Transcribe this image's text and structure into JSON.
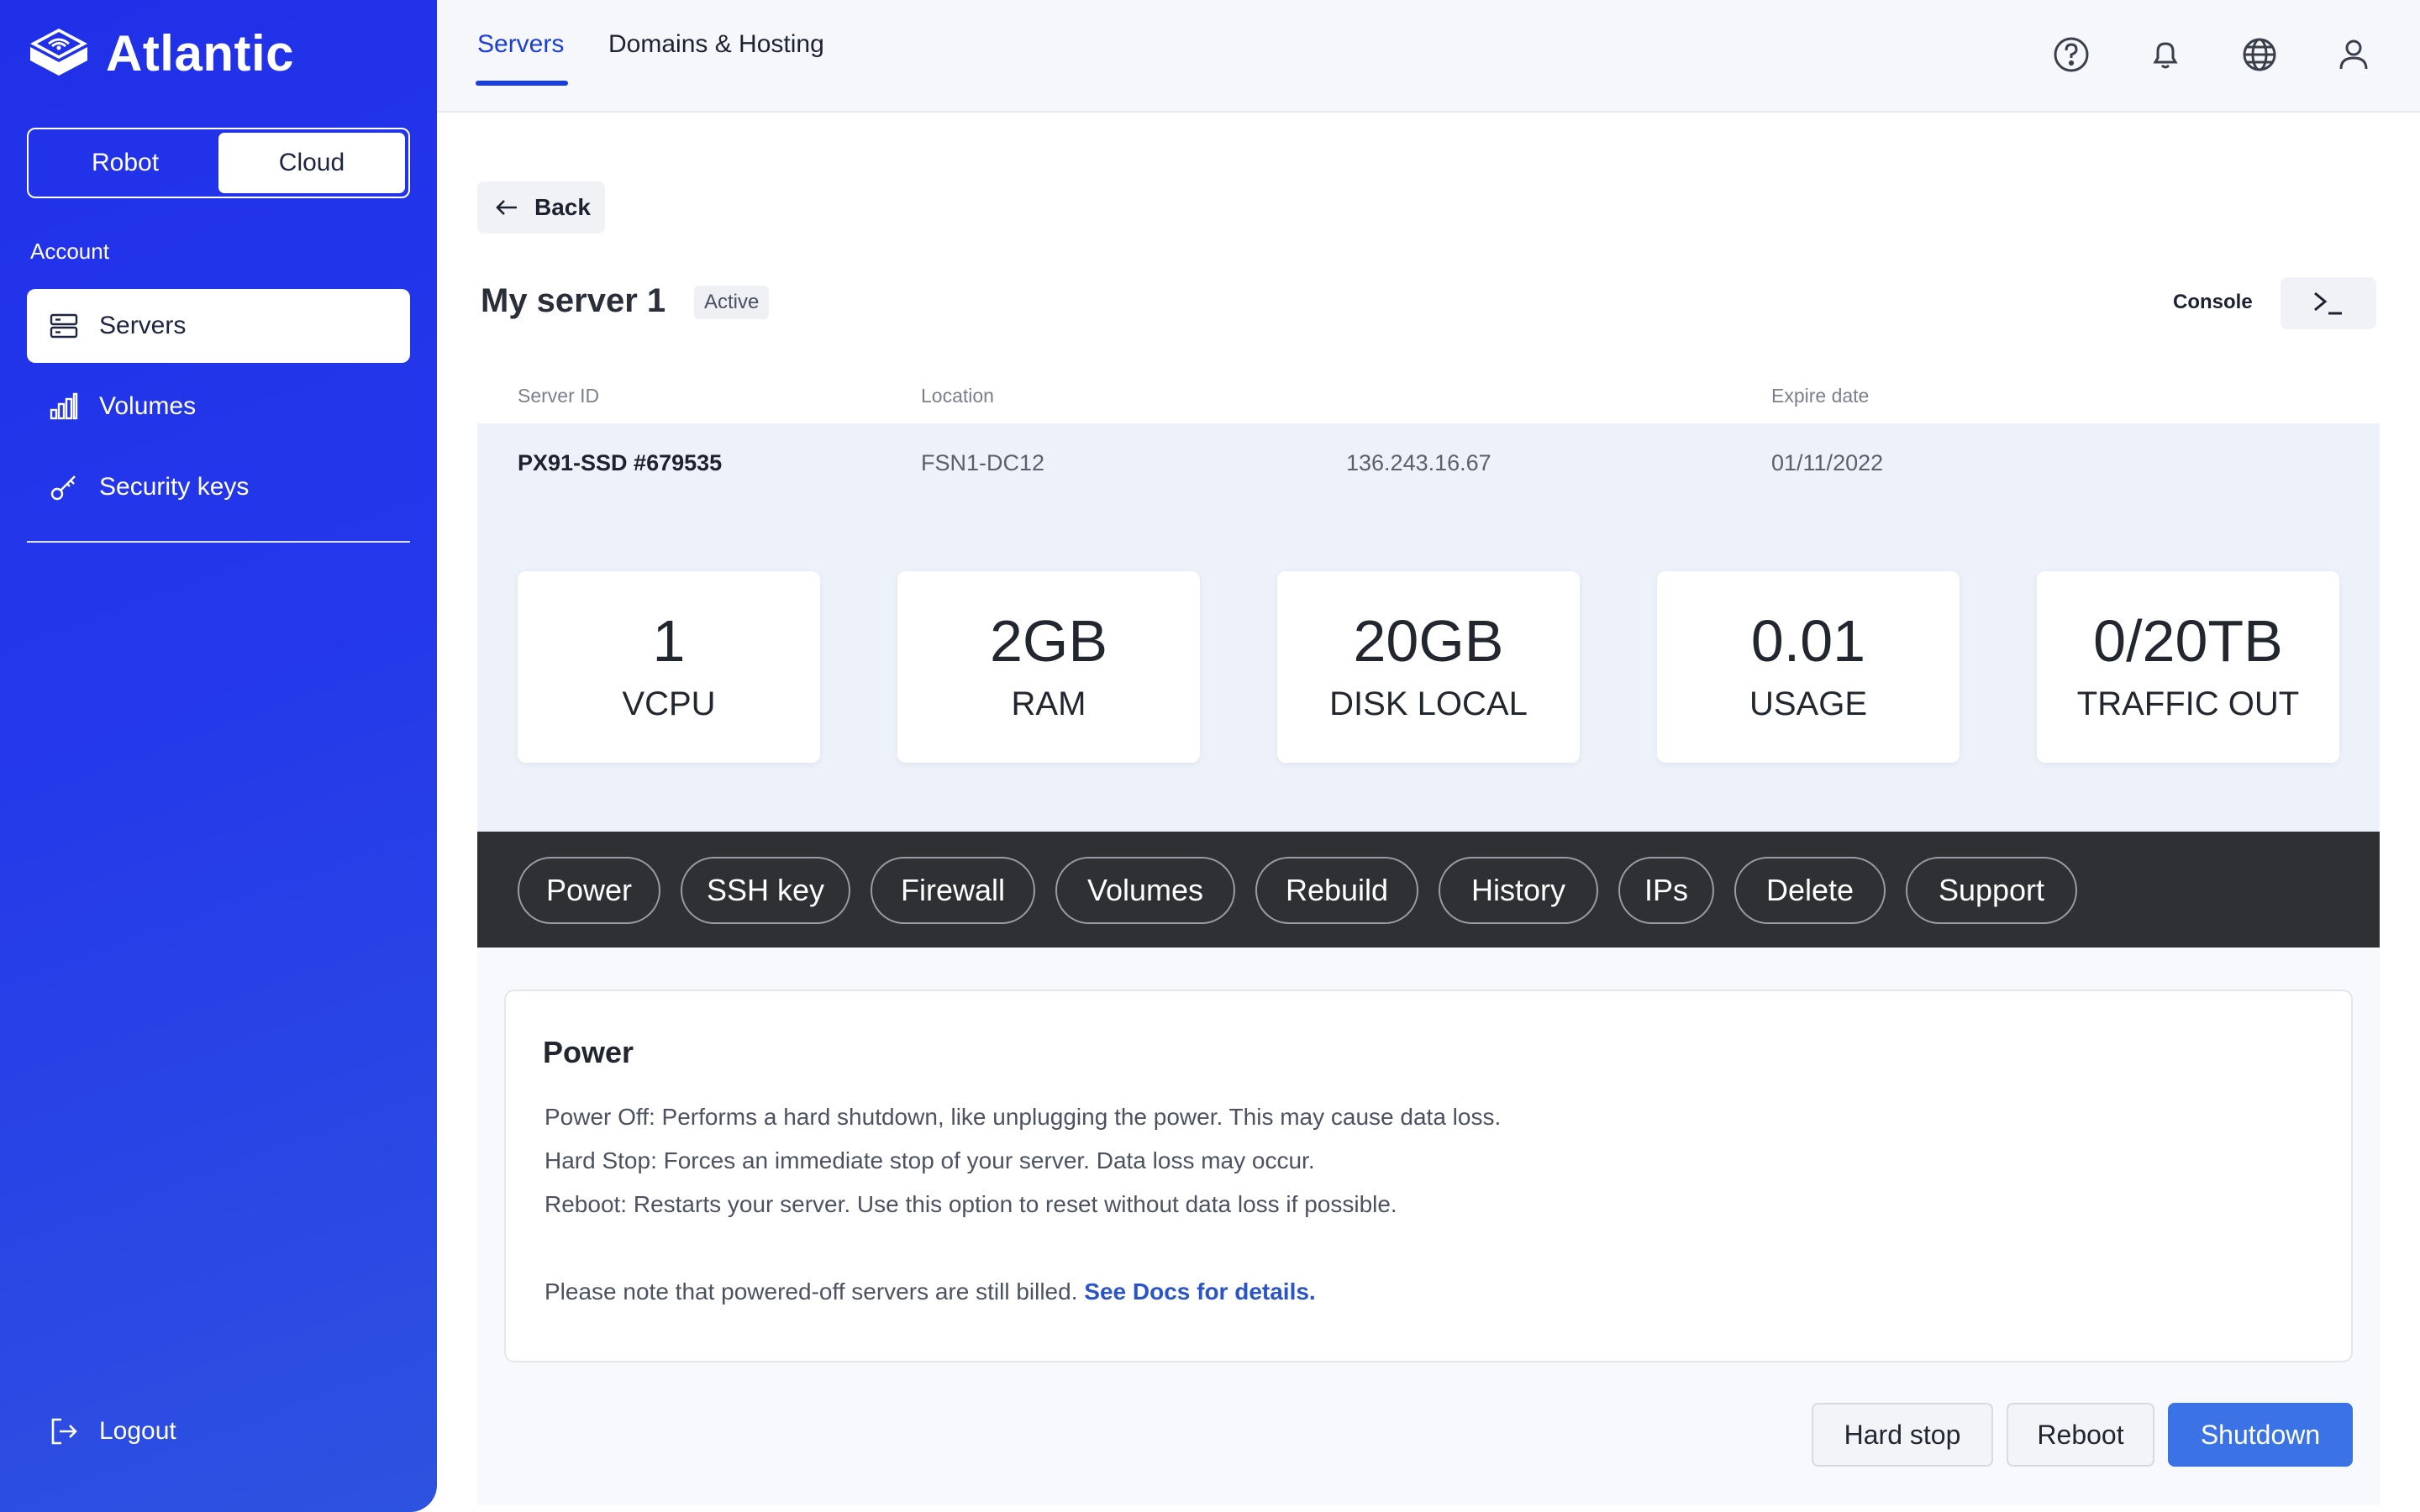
{
  "brand": {
    "name": "Atlantic"
  },
  "sidebar": {
    "switch": {
      "options": [
        "Robot",
        "Cloud"
      ],
      "selected": "Cloud"
    },
    "section_label": "Account",
    "items": [
      {
        "label": "Servers",
        "icon": "server-icon",
        "active": true
      },
      {
        "label": "Volumes",
        "icon": "bar-chart-icon",
        "active": false
      },
      {
        "label": "Security keys",
        "icon": "key-icon",
        "active": false
      }
    ],
    "logout_label": "Logout"
  },
  "topbar": {
    "tabs": [
      {
        "label": "Servers",
        "active": true
      },
      {
        "label": "Domains & Hosting",
        "active": false
      }
    ],
    "icons": [
      "help-icon",
      "bell-icon",
      "globe-icon",
      "user-icon"
    ]
  },
  "server": {
    "back_label": "Back",
    "name": "My server 1",
    "status": "Active",
    "console_label": "Console",
    "columns": [
      "Server ID",
      "Location",
      "Expire date"
    ],
    "id": "PX91-SSD #679535",
    "location": "FSN1-DC12",
    "ip": "136.243.16.67",
    "expire_date": "01/11/2022",
    "stats": [
      {
        "value": "1",
        "label": "VCPU"
      },
      {
        "value": "2GB",
        "label": "RAM"
      },
      {
        "value": "20GB",
        "label": "DISK LOCAL"
      },
      {
        "value": "0.01",
        "label": "USAGE"
      },
      {
        "value": "0/20TB",
        "label": "TRAFFIC OUT"
      }
    ]
  },
  "actions": [
    "Power",
    "SSH key",
    "Firewall",
    "Volumes",
    "Rebuild",
    "History",
    "IPs",
    "Delete",
    "Support"
  ],
  "power": {
    "title": "Power",
    "lines": [
      "Power Off: Performs a hard shutdown, like unplugging the power. This may cause data loss.",
      "Hard Stop: Forces an immediate stop of your server. Data loss may occur.",
      "Reboot: Restarts your server. Use this option to reset without data loss if possible."
    ],
    "note": "Please note that powered-off servers are still billed.",
    "note_link": "See Docs for details.",
    "buttons": {
      "hard_stop": "Hard stop",
      "reboot": "Reboot",
      "shutdown": "Shutdown"
    }
  },
  "colors": {
    "brand_blue": "#2030e8",
    "accent": "#1a3fd6",
    "primary_button": "#3b73e6",
    "action_bar": "#2f3034"
  }
}
